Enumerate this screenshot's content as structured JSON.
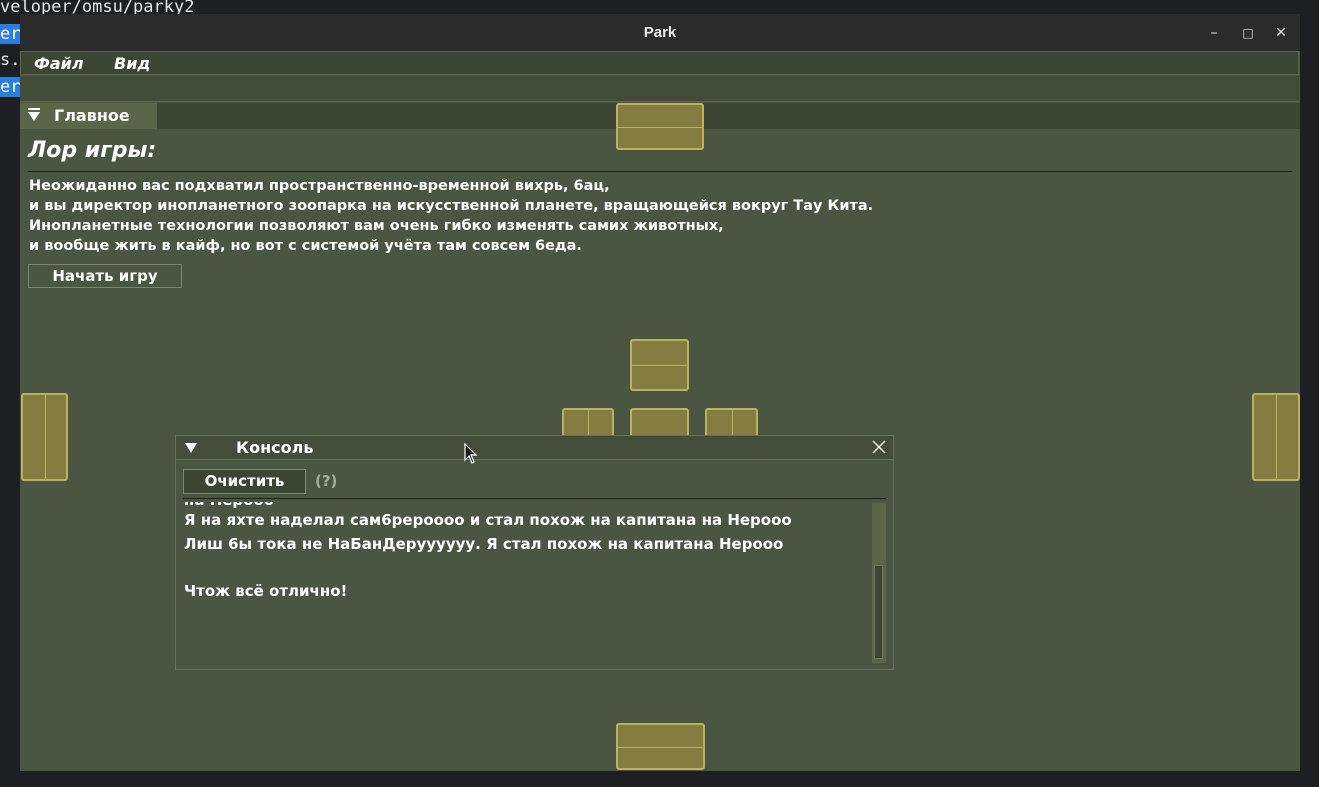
{
  "terminal": {
    "line1": "veloper/omsu/parky2",
    "line2": "er",
    "line3": "s.",
    "line4": "er"
  },
  "window": {
    "title": "Park",
    "minimize_glyph": "–",
    "maximize_glyph": "□",
    "close_glyph": "✕"
  },
  "menu": {
    "file": "Файл",
    "view": "Вид"
  },
  "main": {
    "tab_label": "Главное",
    "lore_title": "Лор игры:",
    "lore_text": "Неожиданно вас подхватил пространственно-временной вихрь, 6ац,\nи вы директор инопланетного зоопарка на искусственной планете, вращающейся вокруг Тау Кита.\nИнопланетные технологии позволяют вам очень гибко изменять самих животных,\nи вообще жить в кайф, но вот с системой учёта там совсем 6еда.",
    "start_button": "Начать игру"
  },
  "console": {
    "title": "Консоль",
    "clear_button": "Очистить",
    "help": "(?)",
    "log": [
      "на Нероoo",
      "Я на яхте наделал сам6рерoooo и стал похож на капитана на Нероoo",
      "Лиш 6ы тока не НаБанДеруууууу. Я стал похож на капитана Нероoo",
      "",
      "Чтож всё отлично!"
    ]
  },
  "colors": {
    "window_bg": "#4a5641",
    "dock_fill": "#857c40",
    "dock_border": "#bcb162"
  }
}
